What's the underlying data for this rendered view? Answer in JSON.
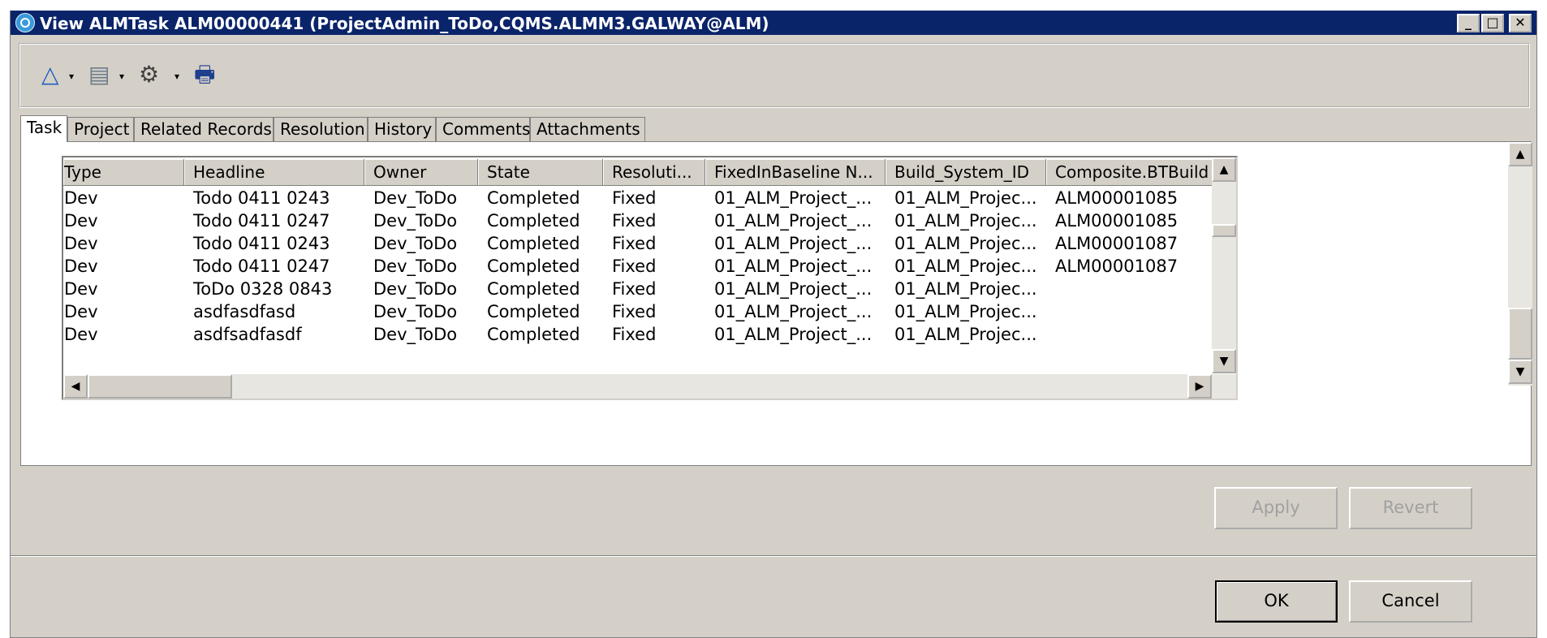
{
  "window": {
    "title": "View ALMTask ALM00000441 (ProjectAdmin_ToDo,CQMS.ALMM3.GALWAY@ALM)",
    "controls": [
      "_",
      "□",
      "✕"
    ]
  },
  "toolbar": {
    "icons": [
      "change-state-icon",
      "actions-icon",
      "utilities-icon",
      "print-icon"
    ],
    "glyphs": [
      "△",
      "▤",
      "⚙",
      "🖶"
    ],
    "dropdown_arrow": "▾"
  },
  "tabs": [
    {
      "label": "Task",
      "active": true
    },
    {
      "label": "Project",
      "active": false
    },
    {
      "label": "Related Records",
      "active": false
    },
    {
      "label": "Resolution",
      "active": false
    },
    {
      "label": "History",
      "active": false
    },
    {
      "label": "Comments",
      "active": false
    },
    {
      "label": "Attachments",
      "active": false
    }
  ],
  "grid": {
    "columns": [
      "Type",
      "Headline",
      "Owner",
      "State",
      "Resoluti...",
      "FixedInBaseline N...",
      "Build_System_ID",
      "Composite.BTBuild"
    ],
    "rows": [
      [
        "Dev",
        "Todo 0411 0243",
        "Dev_ToDo",
        "Completed",
        "Fixed",
        "01_ALM_Project_...",
        "01_ALM_Projec...",
        "ALM00001085"
      ],
      [
        "Dev",
        "Todo 0411 0247",
        "Dev_ToDo",
        "Completed",
        "Fixed",
        "01_ALM_Project_...",
        "01_ALM_Projec...",
        "ALM00001085"
      ],
      [
        "Dev",
        "Todo 0411 0243",
        "Dev_ToDo",
        "Completed",
        "Fixed",
        "01_ALM_Project_...",
        "01_ALM_Projec...",
        "ALM00001087"
      ],
      [
        "Dev",
        "Todo 0411 0247",
        "Dev_ToDo",
        "Completed",
        "Fixed",
        "01_ALM_Project_...",
        "01_ALM_Projec...",
        "ALM00001087"
      ],
      [
        "Dev",
        "ToDo 0328 0843",
        "Dev_ToDo",
        "Completed",
        "Fixed",
        "01_ALM_Project_...",
        "01_ALM_Projec...",
        ""
      ],
      [
        "Dev",
        "asdfasdfasd",
        "Dev_ToDo",
        "Completed",
        "Fixed",
        "01_ALM_Project_...",
        "01_ALM_Projec...",
        ""
      ],
      [
        "Dev",
        "asdfsadfasdf",
        "Dev_ToDo",
        "Completed",
        "Fixed",
        "01_ALM_Project_...",
        "01_ALM_Projec...",
        ""
      ]
    ],
    "scroll_arrows": {
      "up": "▲",
      "down": "▼",
      "left": "◀",
      "right": "▶"
    }
  },
  "buttons": {
    "apply": "Apply",
    "revert": "Revert",
    "ok": "OK",
    "cancel": "Cancel"
  }
}
